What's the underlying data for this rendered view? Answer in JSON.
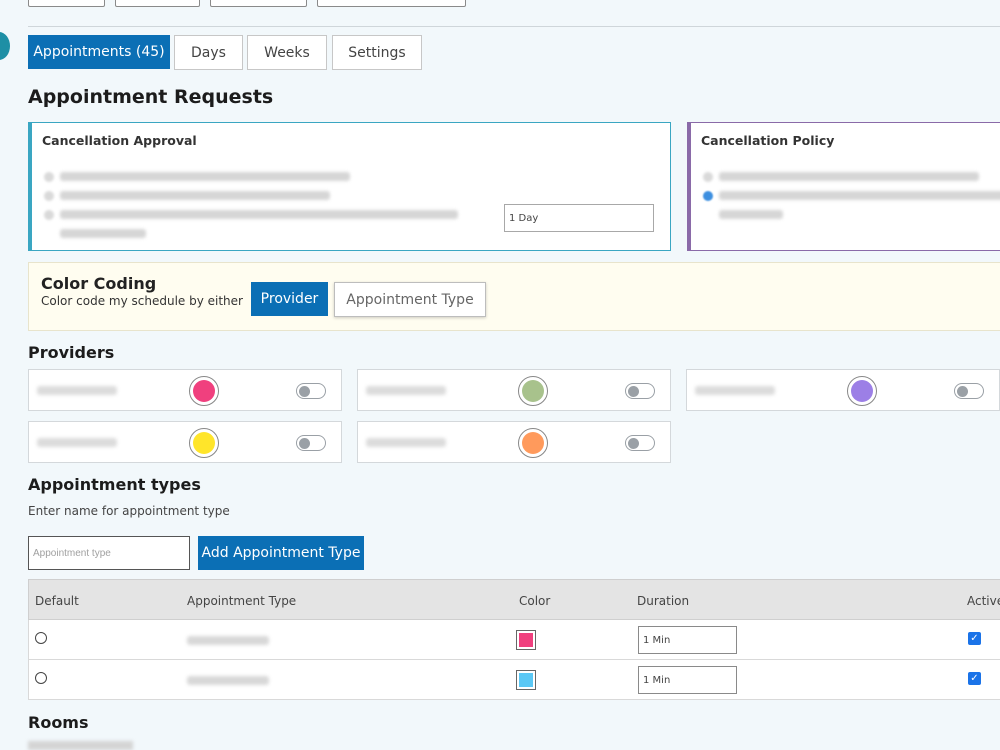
{
  "tabs": [
    {
      "label": "Appointments (45)",
      "active": true
    },
    {
      "label": "Days",
      "active": false
    },
    {
      "label": "Weeks",
      "active": false
    },
    {
      "label": "Settings",
      "active": false
    }
  ],
  "page_title": "Appointment Requests",
  "cancellation_approval": {
    "title": "Cancellation Approval",
    "days_value": "1 Day"
  },
  "cancellation_policy": {
    "title": "Cancellation Policy"
  },
  "color_coding": {
    "title": "Color Coding",
    "subtitle": "Color code my schedule by either",
    "provider_label": "Provider",
    "appointment_type_label": "Appointment Type"
  },
  "providers": {
    "title": "Providers",
    "items": [
      {
        "color": "#f0407e"
      },
      {
        "color": "#a8c28c"
      },
      {
        "color": "#9c7fe6"
      },
      {
        "color": "#ffe52a"
      },
      {
        "color": "#ff9a5c"
      }
    ]
  },
  "appointment_types": {
    "title": "Appointment types",
    "hint": "Enter name for appointment type",
    "input_placeholder": "Appointment type",
    "add_button": "Add Appointment Type",
    "columns": [
      "Default",
      "Appointment Type",
      "Color",
      "Duration",
      "Active"
    ],
    "rows": [
      {
        "color": "#f0407e",
        "duration": "1 Min",
        "active": true
      },
      {
        "color": "#5bc8f5",
        "duration": "1 Min",
        "active": true
      }
    ]
  },
  "rooms": {
    "title": "Rooms"
  }
}
